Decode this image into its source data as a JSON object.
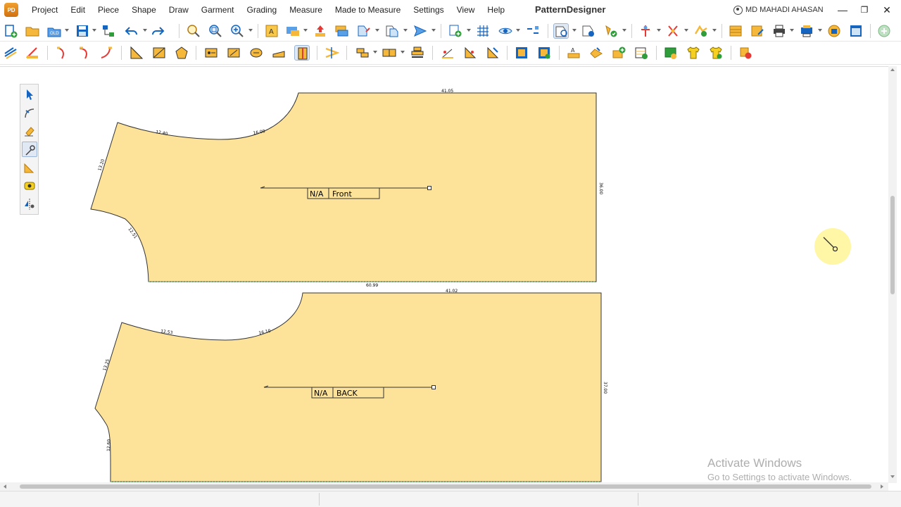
{
  "app": {
    "title": "PatternDesigner",
    "logo_text": "PD"
  },
  "menu": [
    "Project",
    "Edit",
    "Piece",
    "Shape",
    "Draw",
    "Garment",
    "Grading",
    "Measure",
    "Made to Measure",
    "Settings",
    "View",
    "Help"
  ],
  "user": {
    "name": "MD MAHADI AHASAN"
  },
  "window_controls": {
    "minimize": "—",
    "restore": "❐",
    "close": "✕"
  },
  "pieces": [
    {
      "name": "Front",
      "size": "N/A",
      "fill": "#fde39a",
      "measurements": {
        "top": "41.05",
        "shoulder": "12.40",
        "neck": "16.00",
        "armhole_top": "13.20",
        "armhole_bottom": "12.51",
        "side": "36.00",
        "bottom": "60.99"
      }
    },
    {
      "name": "BACK",
      "size": "N/A",
      "fill": "#fde39a",
      "measurements": {
        "top": "41.02",
        "shoulder": "12.53",
        "neck": "16.10",
        "armhole_top": "13.25",
        "armhole_bottom": "12.60",
        "side": "37.00",
        "bottom": "61.05"
      }
    }
  ],
  "palette_tools": [
    "select-tool-icon",
    "curve-tool-icon",
    "eraser-tool-icon",
    "pin-tool-icon",
    "ruler-tool-icon",
    "tape-measure-icon",
    "mirror-tool-icon"
  ],
  "watermark": {
    "title": "Activate Windows",
    "subtitle": "Go to Settings to activate Windows."
  },
  "colors": {
    "piece_fill": "#fde39a",
    "accent": "#1565c0",
    "cursor_highlight": "#fff59a"
  }
}
